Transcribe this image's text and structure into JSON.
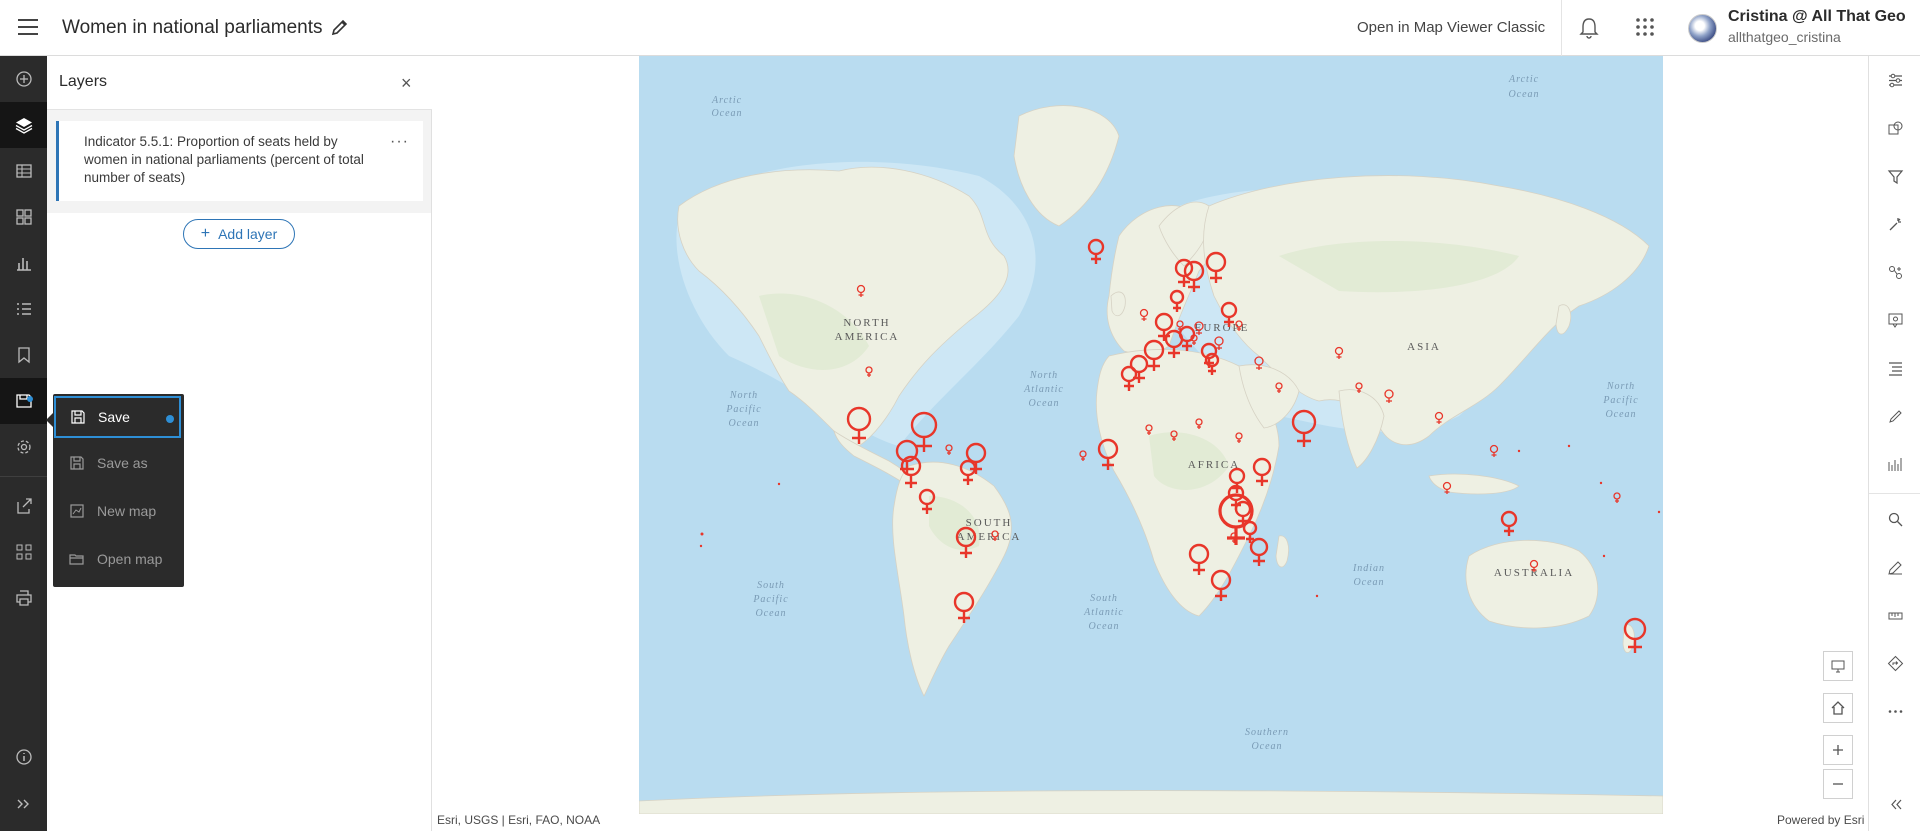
{
  "header": {
    "title": "Women in national parliaments",
    "classic_link": "Open in Map Viewer Classic",
    "user_name": "Cristina @ All That Geo",
    "user_id": "allthatgeo_cristina"
  },
  "left_toolbar": {
    "items": [
      "add-icon",
      "layers-icon",
      "table-icon",
      "basemap-icon",
      "charts-icon",
      "legend-icon",
      "bookmarks-icon",
      "save-icon",
      "settings-icon",
      "share-icon",
      "apps-icon",
      "print-icon",
      "info-icon",
      "expand-icon"
    ]
  },
  "layers_panel": {
    "title": "Layers",
    "layer_name": "Indicator 5.5.1: Proportion of seats held by women in national parliaments (percent of total number of seats)",
    "add_layer": "Add layer"
  },
  "save_menu": {
    "items": [
      {
        "label": "Save",
        "icon": "save-icon"
      },
      {
        "label": "Save as",
        "icon": "save-as-icon"
      },
      {
        "label": "New map",
        "icon": "new-map-icon"
      },
      {
        "label": "Open map",
        "icon": "open-map-icon"
      }
    ]
  },
  "map": {
    "ocean_labels": [
      "Arctic Ocean",
      "Arctic Ocean",
      "North Pacific Ocean",
      "North Atlantic Ocean",
      "North Pacific Ocean",
      "South Pacific Ocean",
      "South Atlantic Ocean",
      "Indian Ocean",
      "Southern Ocean"
    ],
    "continent_labels": [
      "NORTH AMERICA",
      "EUROPE",
      "ASIA",
      "AFRICA",
      "SOUTH AMERICA",
      "AUSTRALIA"
    ],
    "attribution": "Esri, USGS | Esri, FAO, NOAA",
    "powered_by": "Powered by Esri",
    "symbol_color": "#e8362a"
  },
  "right_toolbar": {
    "items": [
      "properties-icon",
      "styles-icon",
      "filter-icon",
      "effects-icon",
      "analysis-icon",
      "configure-popups-icon",
      "fields-icon",
      "sketch-icon",
      "measure-icon",
      "search-icon",
      "edit-icon",
      "measurement-icon",
      "directions-icon",
      "more-icon",
      "collapse-icon"
    ]
  }
}
